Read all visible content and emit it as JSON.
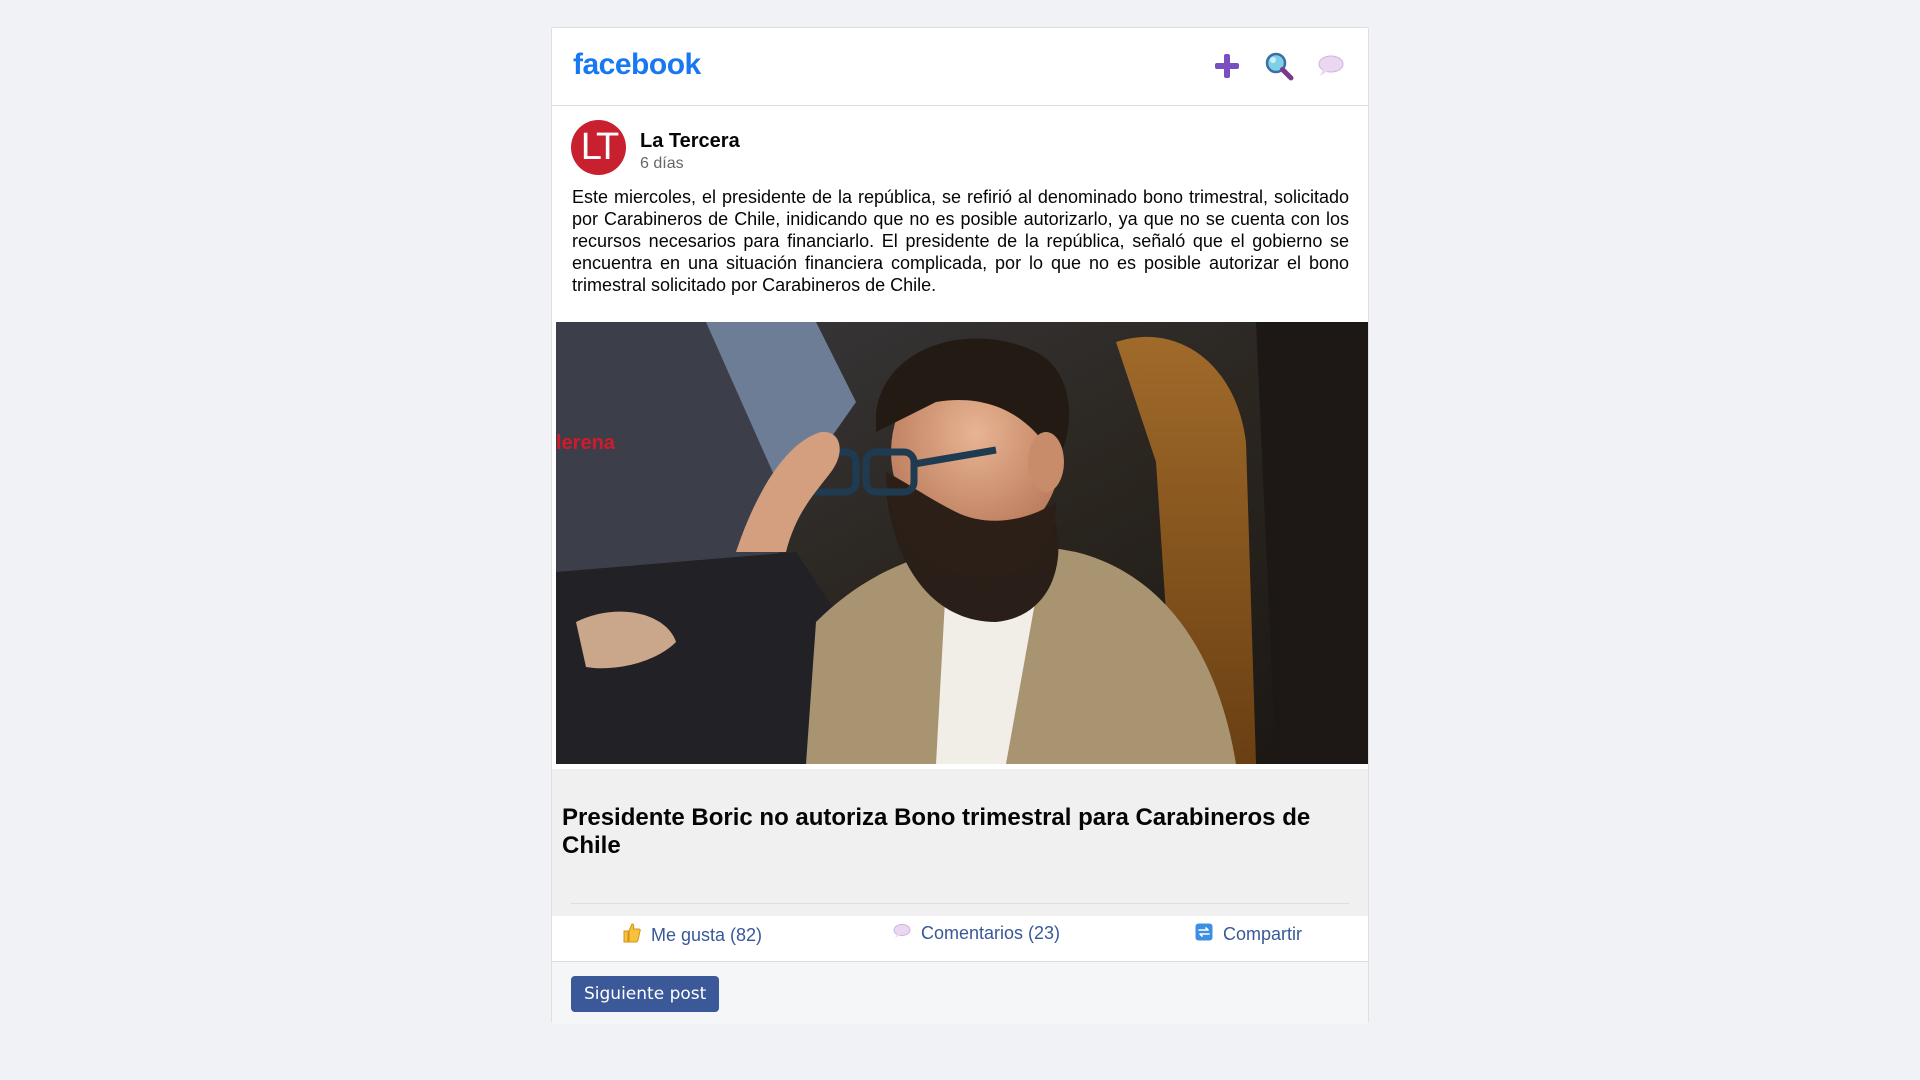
{
  "topbar": {
    "logo": "facebook",
    "icons": [
      "plus-icon",
      "search-icon",
      "chat-bubble-icon"
    ]
  },
  "post": {
    "avatar_text": "LT",
    "author": "La Tercera",
    "time": "6 días",
    "text": "Este miercoles, el presidente de la república, se refirió al denominado bono trimestral, solicitado por Carabineros de Chile, inidicando que no es posible autorizarlo, ya que no se cuenta con los recursos necesarios para financiarlo. El presidente de la república, señaló que el gobierno se encuentra en una situación financiera complicada, por lo que no es posible autorizar el bono trimestral solicitado por Carabineros de Chile.",
    "photo_watermark": "lerena",
    "link_title": "Presidente Boric no autoriza Bono trimestral para Carabineros de Chile"
  },
  "actions": {
    "like": "Me gusta (82)",
    "comment": "Comentarios (23)",
    "share": "Compartir"
  },
  "footer": {
    "next_button": "Siguiente post"
  },
  "colors": {
    "brand": "#1877f2",
    "link": "#385898",
    "button": "#3b5998",
    "avatar": "#c8202f"
  }
}
